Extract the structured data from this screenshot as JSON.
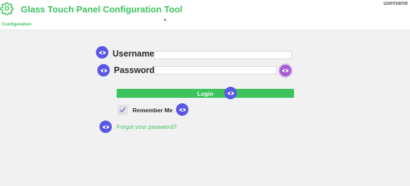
{
  "header": {
    "app_title": "Glass Touch Panel Configuration Tool",
    "user_name": "username",
    "logo_icon": "gear-icon"
  },
  "nav": {
    "configuration_label": "Configuration"
  },
  "login_form": {
    "username_label": "Username",
    "username_value": "",
    "password_label": "Password",
    "password_value": "",
    "login_button_label": "Login",
    "remember_me_label": "Remember Me",
    "remember_me_checked": true,
    "forgot_password_label": "Forgot your password?"
  },
  "colors": {
    "accent_green": "#3cc35e",
    "marker_blue": "#5a57e6",
    "eye_toggle_purple": "#a85ad6",
    "background": "#f1f1f1"
  }
}
